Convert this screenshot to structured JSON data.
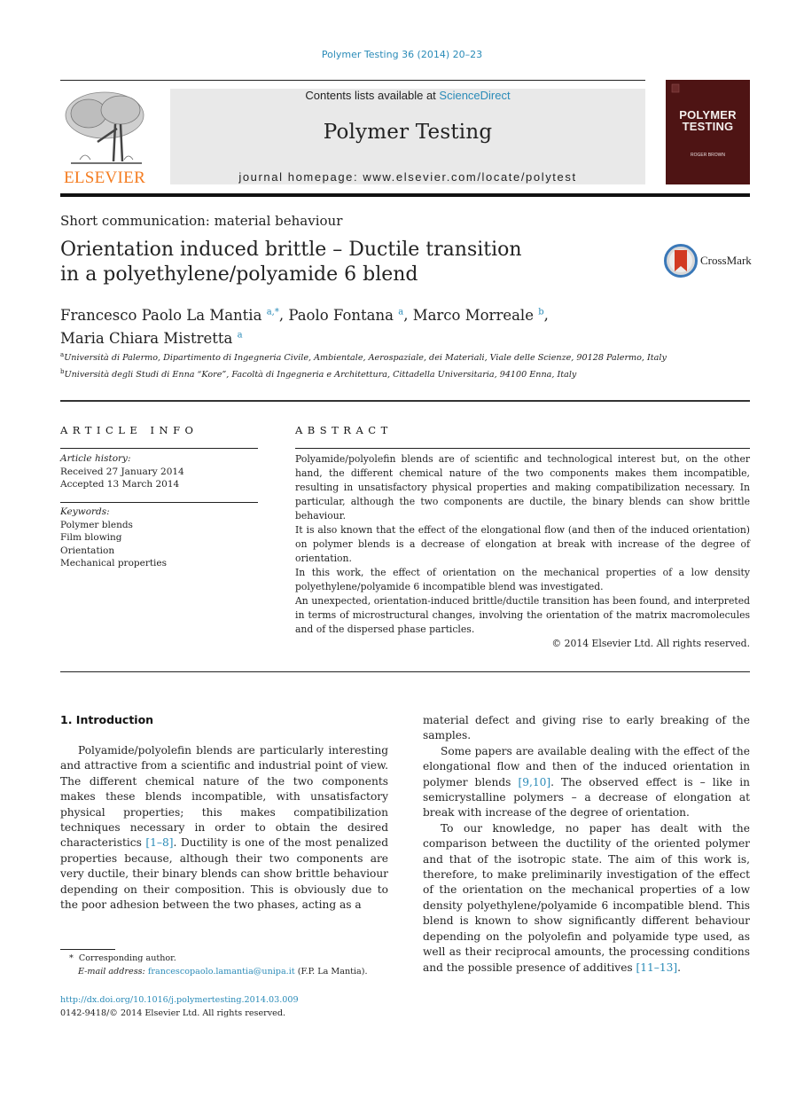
{
  "header": {
    "journal_reference": "Polymer Testing 36 (2014) 20–23",
    "publisher_logo_text": "ELSEVIER",
    "contents_prefix": "Contents lists available at ",
    "contents_link": "ScienceDirect",
    "journal_title": "Polymer Testing",
    "homepage_text": "journal homepage: www.elsevier.com/locate/polytest",
    "cover": {
      "title_line1": "POLYMER",
      "title_line2": "TESTING",
      "editor": "ROGER BROWN",
      "color": "#4e1414"
    }
  },
  "article": {
    "section_type": "Short communication: material behaviour",
    "title_line1": "Orientation induced brittle – Ductile transition",
    "title_line2": "in a polyethylene/polyamide 6 blend",
    "crossmark_label": "CrossMark",
    "authors": [
      {
        "name": "Francesco Paolo La Mantia",
        "sup": "a,*",
        "sep": ", "
      },
      {
        "name": "Paolo Fontana",
        "sup": "a",
        "sep": ", "
      },
      {
        "name": "Marco Morreale",
        "sup": "b",
        "sep": ","
      },
      {
        "name": "Maria Chiara Mistretta",
        "sup": "a",
        "sep": ""
      }
    ],
    "affiliations": [
      {
        "mark": "a",
        "text": "Università di Palermo, Dipartimento di Ingegneria Civile, Ambientale, Aerospaziale, dei Materiali, Viale delle Scienze, 90128 Palermo, Italy"
      },
      {
        "mark": "b",
        "text": "Università degli Studi di Enna “Kore”, Facoltà di Ingegneria e Architettura, Cittadella Universitaria, 94100 Enna, Italy"
      }
    ]
  },
  "article_info": {
    "heading": "ARTICLE INFO",
    "history_label": "Article history:",
    "received": "Received 27 January 2014",
    "accepted": "Accepted 13 March 2014",
    "keywords_label": "Keywords:",
    "keywords": [
      "Polymer blends",
      "Film blowing",
      "Orientation",
      "Mechanical properties"
    ]
  },
  "abstract": {
    "heading": "ABSTRACT",
    "paragraphs": [
      "Polyamide/polyolefin blends are of scientific and technological interest but, on the other hand, the different chemical nature of the two components makes them incompatible, resulting in unsatisfactory physical properties and making compatibilization necessary. In particular, although the two components are ductile, the binary blends can show brittle behaviour.",
      "It is also known that the effect of the elongational flow (and then of the induced orientation) on polymer blends is a decrease of elongation at break with increase of the degree of orientation.",
      "In this work, the effect of orientation on the mechanical properties of a low density polyethylene/polyamide 6 incompatible blend was investigated.",
      "An unexpected, orientation-induced brittle/ductile transition has been found, and interpreted in terms of microstructural changes, involving the orientation of the matrix macromolecules and of the dispersed phase particles."
    ],
    "copyright": "© 2014 Elsevier Ltd. All rights reserved."
  },
  "body": {
    "section_heading": "1.  Introduction",
    "left_p1_before_ref": "Polyamide/polyolefin blends are particularly interesting and attractive from a scientific and industrial point of view. The different chemical nature of the two components makes these blends incompatible, with unsatisfactory physical properties; this makes compatibilization techniques necessary in order to obtain the desired characteristics ",
    "left_p1_ref": "[1–8]",
    "left_p1_after_ref": ". Ductility is one of the most penalized properties because, although their two components are very ductile, their binary blends can show brittle behaviour depending on their composition. This is obviously due to the poor adhesion between the two phases, acting as a",
    "right_p0": "material defect and giving rise to early breaking of the samples.",
    "right_p1_before_ref": "Some papers are available dealing with the effect of the elongational flow and then of the induced orientation in polymer blends ",
    "right_p1_ref": "[9,10]",
    "right_p1_after_ref": ". The observed effect is – like in semicrystalline polymers – a decrease of elongation at break with increase of the degree of orientation.",
    "right_p2_before_ref": "To our knowledge, no paper has dealt with the comparison between the ductility of the oriented polymer and that of the isotropic state. The aim of this work is, therefore, to make preliminarily investigation of the effect of the orientation on the mechanical properties of a low density polyethylene/polyamide 6 incompatible blend. This blend is known to show significantly different behaviour depending on the polyolefin and polyamide type used, as well as their reciprocal amounts, the processing conditions and the possible presence of additives ",
    "right_p2_ref": "[11–13]",
    "right_p2_after_ref": "."
  },
  "footnotes": {
    "corresponding_mark": "*",
    "corresponding_text": "Corresponding author.",
    "email_label": "E-mail address:",
    "email": "francescopaolo.lamantia@unipa.it",
    "email_suffix": " (F.P. La Mantia).",
    "doi": "http://dx.doi.org/10.1016/j.polymertesting.2014.03.009",
    "issn_copyright": "0142-9418/© 2014 Elsevier Ltd. All rights reserved."
  },
  "colors": {
    "link": "#2a8bb8",
    "elsevier_orange": "#f47c20",
    "banner_gray": "#e9e9e9"
  }
}
